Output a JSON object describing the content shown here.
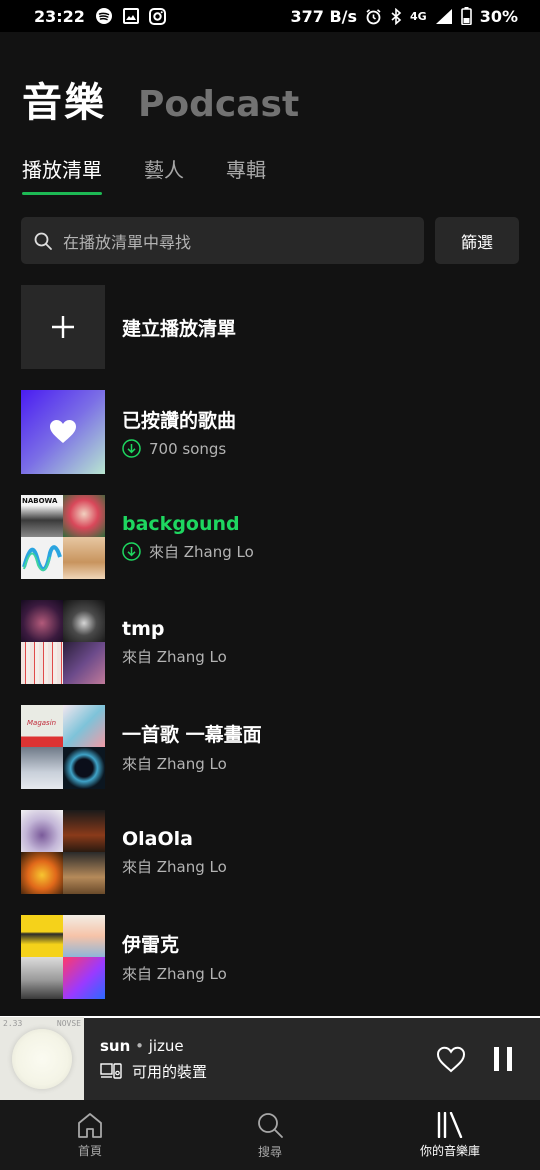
{
  "status_bar": {
    "time": "23:22",
    "net_speed": "377 B/s",
    "network": "4G",
    "battery": "30%",
    "icons": [
      "spotify-icon",
      "image-icon",
      "instagram-icon",
      "alarm-icon",
      "bluetooth-icon",
      "signal-icon",
      "battery-icon"
    ]
  },
  "header": {
    "music": "音樂",
    "podcast": "Podcast"
  },
  "tabs": [
    {
      "label": "播放清單",
      "active": true
    },
    {
      "label": "藝人",
      "active": false
    },
    {
      "label": "專輯",
      "active": false
    }
  ],
  "search": {
    "placeholder": "在播放清單中尋找",
    "filter_label": "篩選"
  },
  "playlists": [
    {
      "name": "建立播放清單",
      "sub": "",
      "type": "create"
    },
    {
      "name": "已按讚的歌曲",
      "sub": "700 songs",
      "downloaded": true,
      "type": "liked"
    },
    {
      "name": "backgound",
      "sub": "來自 Zhang Lo",
      "downloaded": true,
      "playing": true
    },
    {
      "name": "tmp",
      "sub": "來自 Zhang Lo"
    },
    {
      "name": "一首歌 一幕畫面",
      "sub": "來自 Zhang Lo"
    },
    {
      "name": "OlaOla",
      "sub": "來自 Zhang Lo"
    },
    {
      "name": "伊雷克",
      "sub": "來自 Zhang Lo"
    }
  ],
  "thumb_text": {
    "nabowa": "NABOWA",
    "magasin": "Magasin"
  },
  "player": {
    "title": "sun",
    "separator": " • ",
    "artist": "jizue",
    "device": "可用的裝置",
    "progress": 0.97,
    "art_text_left": "2.33",
    "art_text_right": "NOVSE"
  },
  "bottom_nav": [
    {
      "label": "首頁",
      "icon": "home-icon",
      "active": false
    },
    {
      "label": "搜尋",
      "icon": "search-icon",
      "active": false
    },
    {
      "label": "你的音樂庫",
      "icon": "library-icon",
      "active": true
    }
  ],
  "colors": {
    "accent": "#1db954",
    "background": "#121212",
    "surface": "#282828"
  }
}
